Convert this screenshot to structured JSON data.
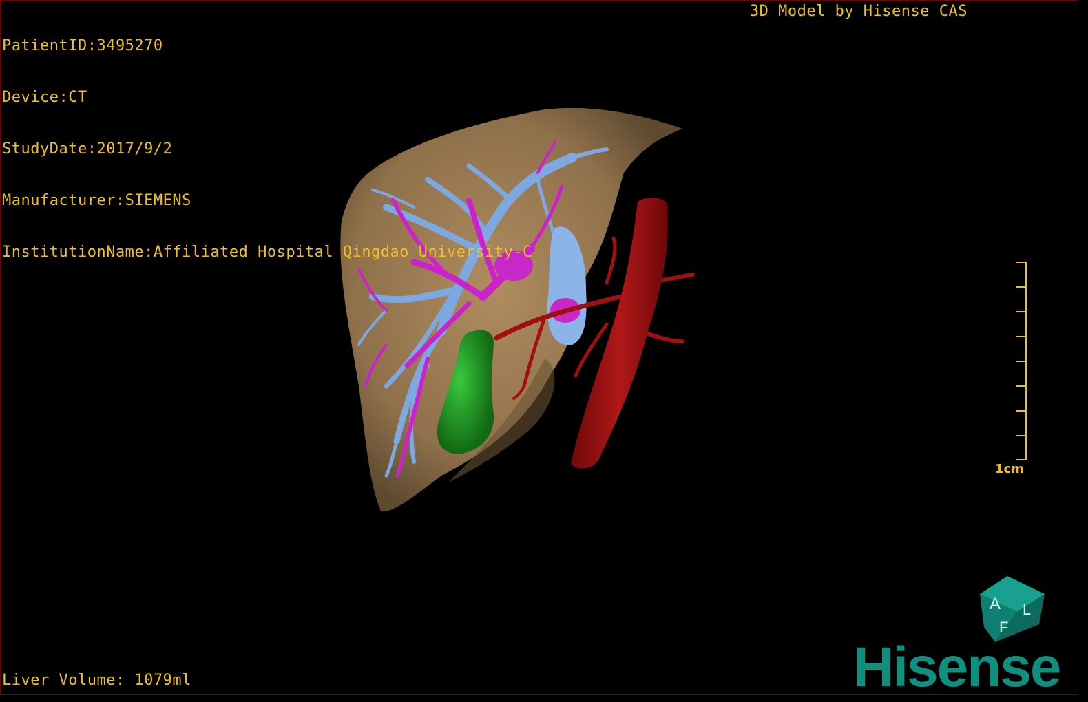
{
  "header": {
    "info_lines": [
      "PatientID:3495270",
      "Device:CT",
      "StudyDate:2017/9/2",
      "Manufacturer:SIEMENS",
      "InstitutionName:Affiliated Hospital Qingdao University-C"
    ],
    "model_credit": "3D Model by Hisense CAS"
  },
  "footer": {
    "liver_volume": "Liver Volume: 1079ml"
  },
  "scale_bar": {
    "label": "1cm",
    "ticks": 9
  },
  "orientation_cube": {
    "faces": [
      "A",
      "F",
      "L"
    ]
  },
  "brand": {
    "logo_text": "Hisense"
  },
  "colors": {
    "overlay_text": "#f0c020",
    "liver": "#a8865c",
    "portal_vein": "#7ea8e0",
    "hepatic_vein": "#cc22cc",
    "artery": "#a01010",
    "gallbladder": "#1d9a22",
    "cube": "#118a7d",
    "logo": "#0f8f7f"
  }
}
